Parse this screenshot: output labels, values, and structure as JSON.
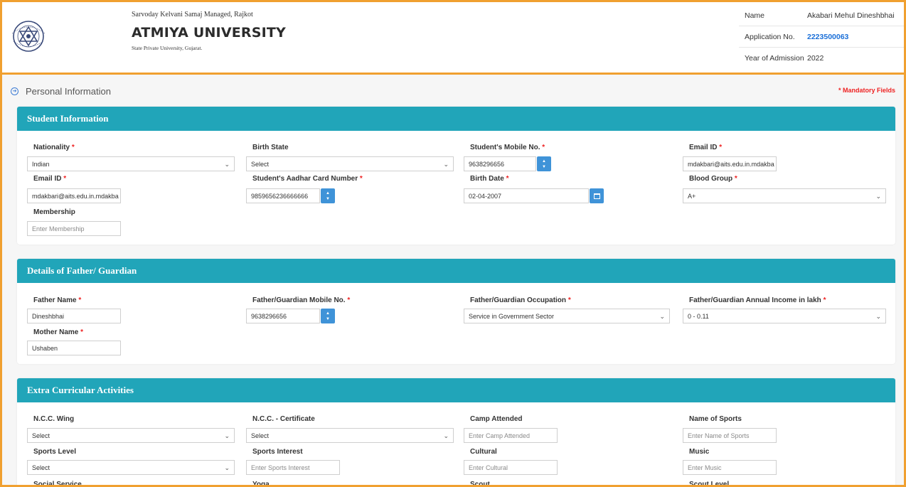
{
  "header": {
    "tagline": "Sarvoday Kelvani Samaj Managed, Rajkot",
    "university": "ATMIYA UNIVERSITY",
    "subtitle": "State Private University, Gujarat.",
    "info": [
      {
        "label": "Name",
        "value": "Akabari Mehul Dineshbhai"
      },
      {
        "label": "Application No.",
        "value": "2223500063"
      },
      {
        "label": "Year of Admission",
        "value": "2022"
      }
    ]
  },
  "section": {
    "title": "Personal Information",
    "mandatory": "* Mandatory Fields"
  },
  "student": {
    "heading": "Student Information",
    "nationality": {
      "label": "Nationality",
      "value": "Indian"
    },
    "birth_state": {
      "label": "Birth State",
      "value": "Select"
    },
    "mobile": {
      "label": "Student's Mobile No.",
      "value": "9638296656"
    },
    "email1": {
      "label": "Email ID",
      "value": "mdakbari@aits.edu.in.mdakba"
    },
    "email2": {
      "label": "Email ID",
      "value": "mdakbari@aits.edu.in.mdakba"
    },
    "aadhar": {
      "label": "Student's Aadhar Card Number",
      "value": "9859656236666666"
    },
    "birth_date": {
      "label": "Birth Date",
      "value": "02-04-2007"
    },
    "blood_group": {
      "label": "Blood Group",
      "value": "A+"
    },
    "membership": {
      "label": "Membership",
      "placeholder": "Enter Membership"
    }
  },
  "father": {
    "heading": "Details of Father/ Guardian",
    "father_name": {
      "label": "Father Name",
      "value": "Dineshbhai"
    },
    "mobile": {
      "label": "Father/Guardian Mobile No.",
      "value": "9638296656"
    },
    "occupation": {
      "label": "Father/Guardian Occupation",
      "value": "Service in Government Sector"
    },
    "income": {
      "label": "Father/Guardian Annual Income in lakh",
      "value": "0 - 0.11"
    },
    "mother_name": {
      "label": "Mother Name",
      "value": "Ushaben"
    }
  },
  "extra": {
    "heading": "Extra Curricular Activities",
    "ncc_wing": {
      "label": "N.C.C. Wing",
      "value": "Select"
    },
    "ncc_cert": {
      "label": "N.C.C. - Certificate",
      "value": "Select"
    },
    "camp": {
      "label": "Camp Attended",
      "placeholder": "Enter Camp Attended"
    },
    "sports_name": {
      "label": "Name of Sports",
      "placeholder": "Enter Name of Sports"
    },
    "sports_level": {
      "label": "Sports Level",
      "value": "Select"
    },
    "sports_interest": {
      "label": "Sports Interest",
      "placeholder": "Enter Sports Interest"
    },
    "cultural": {
      "label": "Cultural",
      "placeholder": "Enter Cultural"
    },
    "music": {
      "label": "Music",
      "placeholder": "Enter Music"
    },
    "social_service": {
      "label": "Social Service"
    },
    "yoga": {
      "label": "Yoga"
    },
    "scout": {
      "label": "Scout"
    },
    "scout_level": {
      "label": "Scout Level"
    }
  },
  "required_mark": "*",
  "colors": {
    "accent_border": "#f0a030",
    "card_header": "#21a5b9",
    "link_blue": "#1a6fd8",
    "required": "#ee2222",
    "spinner": "#3f93d8"
  }
}
